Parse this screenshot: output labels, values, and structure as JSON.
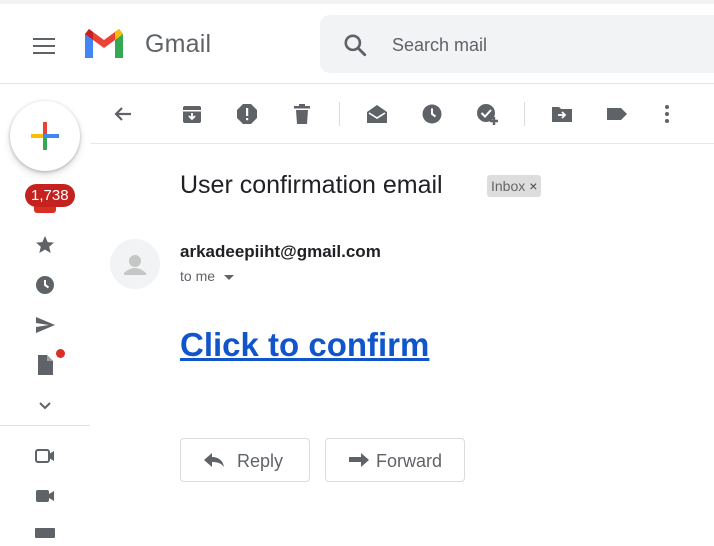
{
  "header": {
    "app_name": "Gmail",
    "search_placeholder": "Search mail"
  },
  "sidebar": {
    "inbox_count": "1,738"
  },
  "message": {
    "subject": "User confirmation email",
    "label": "Inbox",
    "label_remove": "×",
    "sender": "arkadeepiiht@gmail.com",
    "recipient_line": "to me",
    "body_link": "Click to confirm"
  },
  "actions": {
    "reply": "Reply",
    "forward": "Forward"
  },
  "colors": {
    "link": "#1155cc",
    "badge": "#c5221f",
    "icon": "#5f6368"
  }
}
